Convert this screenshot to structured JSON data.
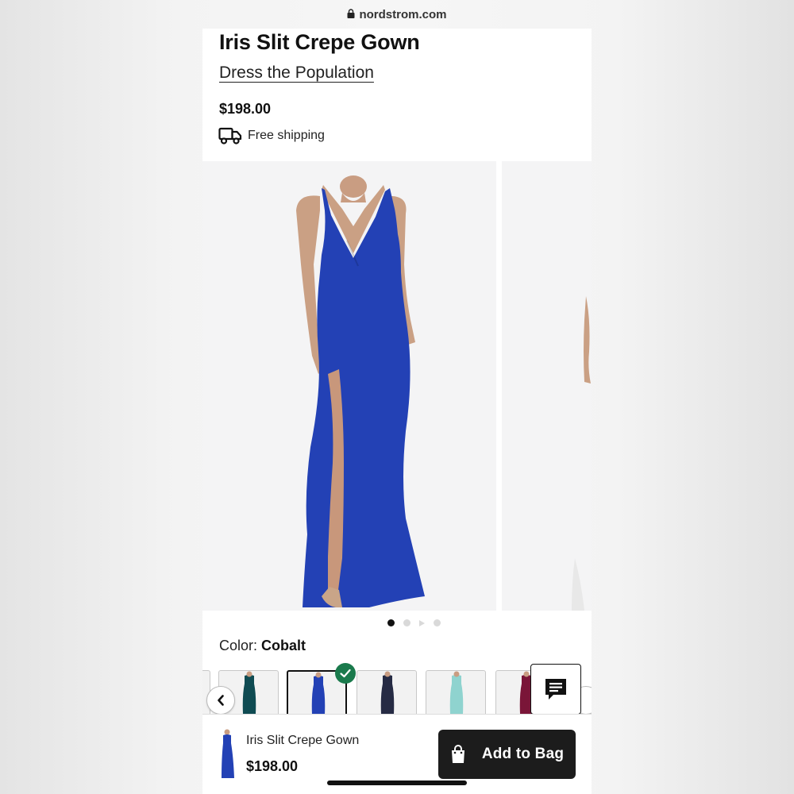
{
  "browser": {
    "url": "nordstrom.com",
    "lock_icon": "lock-icon"
  },
  "product": {
    "title": "Iris Slit Crepe Gown",
    "brand": "Dress the Population",
    "price": "$198.00",
    "shipping_label": "Free shipping",
    "shipping_icon": "truck-icon"
  },
  "gallery": {
    "dress_color": "#2341b5",
    "image_count": 4,
    "active_index": 0
  },
  "color_selector": {
    "label": "Color:",
    "selected": "Cobalt",
    "swatches": [
      {
        "color": "#0f4b52"
      },
      {
        "color": "#2341b5"
      },
      {
        "color": "#262b44"
      },
      {
        "color": "#8fd3cf"
      },
      {
        "color": "#7a1538"
      }
    ],
    "selected_index": 1,
    "check_color": "#1a7a4c"
  },
  "bottom_bar": {
    "name": "Iris Slit Crepe Gown",
    "price": "$198.00",
    "add_label": "Add to Bag",
    "bag_icon": "shopping-bag-icon"
  },
  "chat": {
    "icon": "chat-icon"
  }
}
